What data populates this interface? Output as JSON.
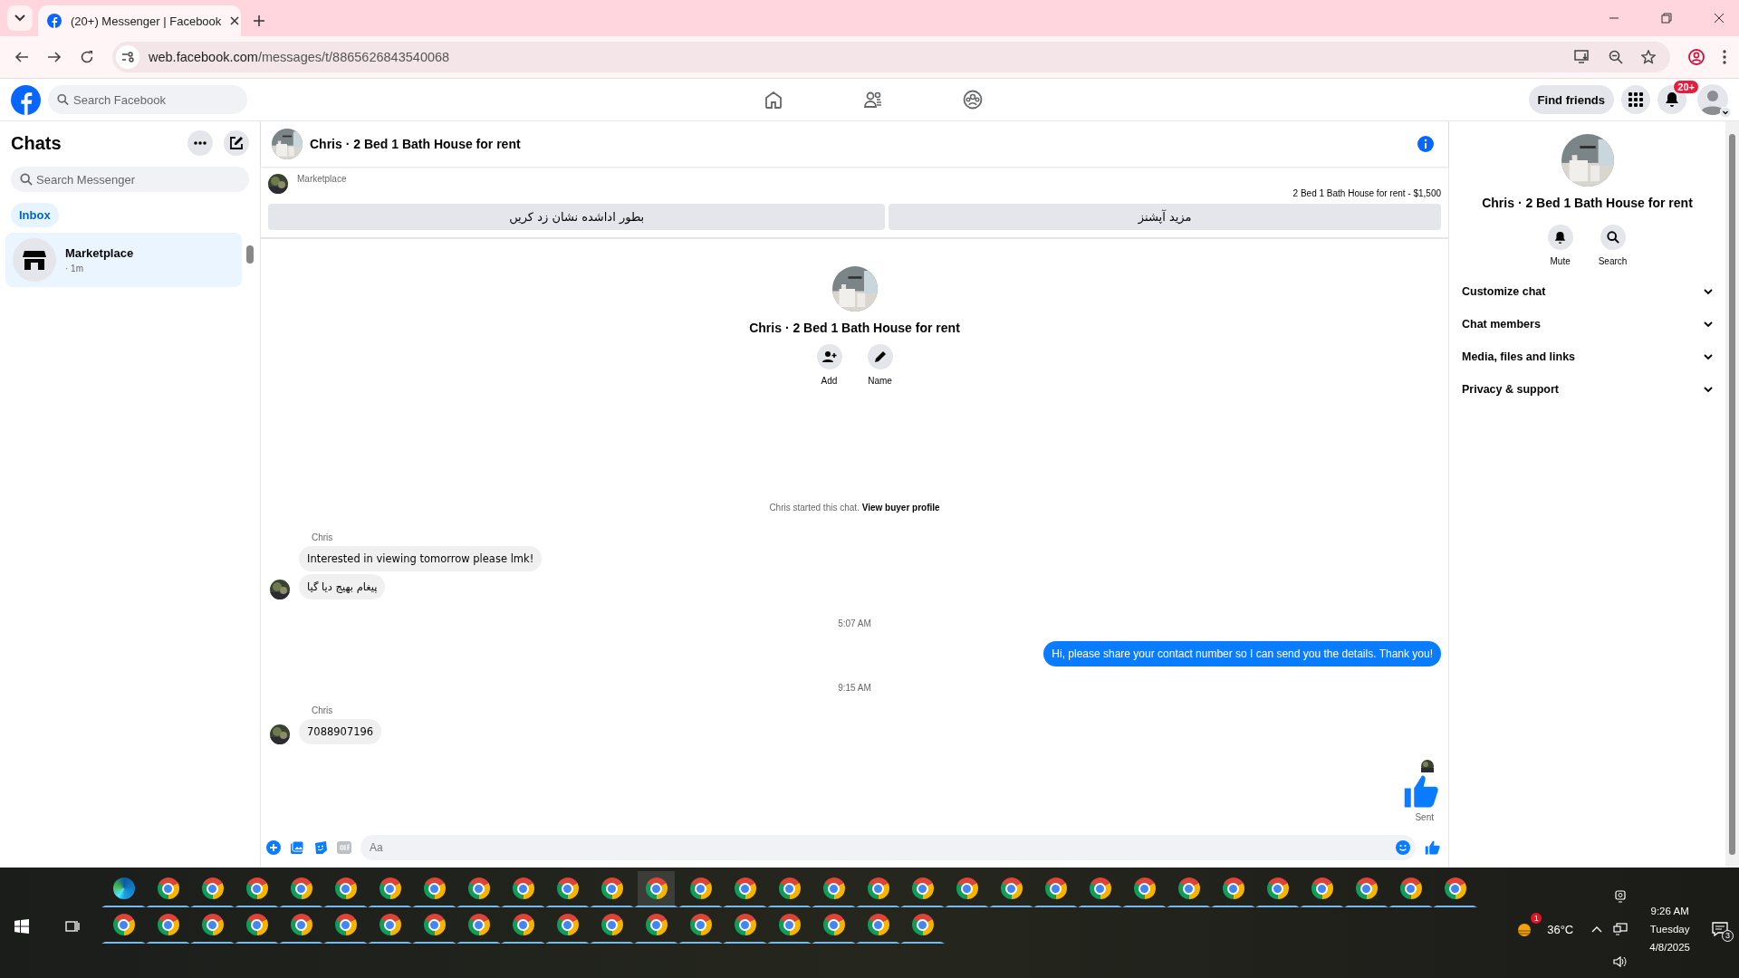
{
  "browser": {
    "tab": {
      "title": "(20+) Messenger | Facebook"
    },
    "url": {
      "host": "web.facebook.com",
      "path": "/messages/t/8865626843540068"
    }
  },
  "header": {
    "search_placeholder": "Search Facebook",
    "nav": [
      {
        "kind": "home"
      },
      {
        "kind": "friends"
      },
      {
        "kind": "groups"
      }
    ],
    "find_friends": "Find friends",
    "notification_badge": "20+"
  },
  "sidebar": {
    "title": "Chats",
    "search_placeholder": "Search Messenger",
    "filters": [
      {
        "label": "Inbox",
        "selected": true
      }
    ],
    "chats": [
      {
        "name": "Marketplace",
        "time": "· 1m",
        "selected": true
      }
    ]
  },
  "chat": {
    "title": "Chris · 2 Bed 1 Bath House for rent",
    "banner": {
      "source": "Marketplace",
      "listing": "2 Bed 1 Bath House for rent - $1,500",
      "actions": [
        "مزید آپشنز",
        "بطور اداشده نشان زد کریں"
      ]
    },
    "intro": {
      "name": "Chris · 2 Bed 1 Bath House for rent",
      "actions": [
        {
          "kind": "add",
          "label": "Add"
        },
        {
          "kind": "name",
          "label": "Name"
        }
      ],
      "started": "Chris started this chat.",
      "link": "View buyer profile"
    },
    "messages": [
      {
        "kind": "sender",
        "text": "Chris"
      },
      {
        "kind": "incoming",
        "text": "Interested in viewing tomorrow please lmk!",
        "avatar": false
      },
      {
        "kind": "incoming",
        "text": "پیغام بھیج دیا گیا",
        "avatar": true
      },
      {
        "kind": "time",
        "text": "5:07 AM"
      },
      {
        "kind": "outgoing",
        "text": "Hi, please share your contact number so I can send you the details. Thank you!"
      },
      {
        "kind": "time",
        "text": "9:15 AM"
      },
      {
        "kind": "sender",
        "text": "Chris"
      },
      {
        "kind": "incoming",
        "text": "7088907196",
        "avatar": true
      },
      {
        "kind": "seen"
      },
      {
        "kind": "like"
      },
      {
        "kind": "status",
        "text": "Sent"
      }
    ],
    "composer": {
      "placeholder": "Aa"
    }
  },
  "details": {
    "title": "Chris · 2 Bed 1 Bath House for rent",
    "actions": [
      {
        "kind": "mute",
        "label": "Mute"
      },
      {
        "kind": "search",
        "label": "Search"
      }
    ],
    "sections": [
      "Customize chat",
      "Chat members",
      "Media, files and links",
      "Privacy & support"
    ]
  },
  "taskbar": {
    "rows": [
      [
        {
          "kind": "edge",
          "selected": false
        },
        {
          "kind": "chrome",
          "selected": false
        },
        {
          "kind": "chrome",
          "selected": false
        },
        {
          "kind": "chrome",
          "selected": false
        },
        {
          "kind": "chrome",
          "selected": false
        },
        {
          "kind": "chrome",
          "selected": false
        },
        {
          "kind": "chrome",
          "selected": false
        },
        {
          "kind": "chrome",
          "selected": false
        },
        {
          "kind": "chrome",
          "selected": false
        },
        {
          "kind": "chrome",
          "selected": false
        },
        {
          "kind": "chrome",
          "selected": false
        },
        {
          "kind": "chrome",
          "selected": false
        },
        {
          "kind": "chrome",
          "selected": true
        },
        {
          "kind": "chrome",
          "selected": false
        },
        {
          "kind": "chrome",
          "selected": false
        },
        {
          "kind": "chrome",
          "selected": false
        },
        {
          "kind": "chrome",
          "selected": false
        },
        {
          "kind": "chrome",
          "selected": false
        },
        {
          "kind": "chrome",
          "selected": false
        },
        {
          "kind": "chrome",
          "selected": false
        },
        {
          "kind": "chrome",
          "selected": false
        },
        {
          "kind": "chrome",
          "selected": false
        },
        {
          "kind": "chrome",
          "selected": false
        },
        {
          "kind": "chrome",
          "selected": false
        },
        {
          "kind": "chrome",
          "selected": false
        },
        {
          "kind": "chrome",
          "selected": false
        },
        {
          "kind": "chrome",
          "selected": false
        },
        {
          "kind": "chrome",
          "selected": false
        },
        {
          "kind": "chrome",
          "selected": false
        },
        {
          "kind": "chrome",
          "selected": false
        },
        {
          "kind": "chrome",
          "selected": false
        }
      ],
      [
        {
          "kind": "chrome",
          "selected": false
        },
        {
          "kind": "chrome",
          "selected": false
        },
        {
          "kind": "chrome",
          "selected": false
        },
        {
          "kind": "chrome",
          "selected": false
        },
        {
          "kind": "chrome",
          "selected": false
        },
        {
          "kind": "chrome",
          "selected": false
        },
        {
          "kind": "chrome",
          "selected": false
        },
        {
          "kind": "chrome",
          "selected": false
        },
        {
          "kind": "chrome",
          "selected": false
        },
        {
          "kind": "chrome",
          "selected": false
        },
        {
          "kind": "chrome",
          "selected": false
        },
        {
          "kind": "chrome",
          "selected": false
        },
        {
          "kind": "chrome",
          "selected": false
        },
        {
          "kind": "chrome",
          "selected": false
        },
        {
          "kind": "chrome",
          "selected": false
        },
        {
          "kind": "chrome",
          "selected": false
        },
        {
          "kind": "chrome",
          "selected": false
        },
        {
          "kind": "chrome",
          "selected": false
        },
        {
          "kind": "chrome",
          "selected": false
        }
      ]
    ],
    "weather_badge": "1",
    "temperature": "36°C",
    "clock": {
      "time": "9:26 AM",
      "day": "Tuesday",
      "date": "4/8/2025"
    },
    "notifications": "3"
  }
}
